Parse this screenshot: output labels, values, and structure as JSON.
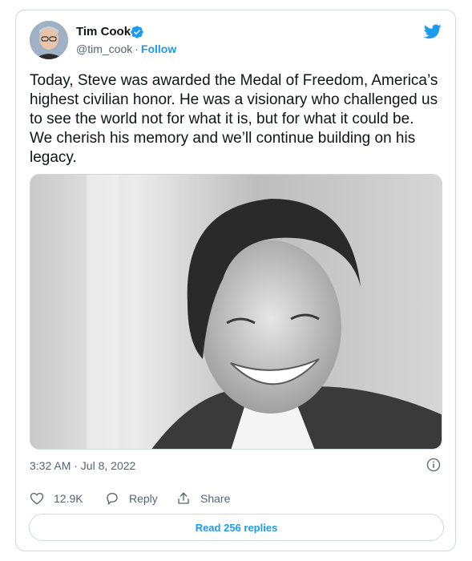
{
  "author": {
    "name": "Tim Cook",
    "handle": "@tim_cook",
    "separator": "·",
    "follow_label": "Follow",
    "verified": true
  },
  "tweet": {
    "text": "Today, Steve was awarded the Medal of Freedom, America’s highest civilian honor. He was a visionary who challenged us to see the world not for what it is, but for what it could be. We cherish his memory and we’ll continue building on his legacy.",
    "timestamp": "3:32 AM · Jul 8, 2022"
  },
  "actions": {
    "likes_count": "12.9K",
    "reply_label": "Reply",
    "share_label": "Share"
  },
  "replies_button_label": "Read 256 replies",
  "colors": {
    "accent": "#1d9bf0",
    "text_primary": "#0f1419",
    "text_secondary": "#536471",
    "border": "#cfd9de"
  },
  "icons": {
    "brand": "twitter-bird-icon",
    "verified": "verified-badge-icon",
    "info": "info-icon",
    "like": "heart-icon",
    "reply": "reply-bubble-icon",
    "share": "share-icon"
  }
}
